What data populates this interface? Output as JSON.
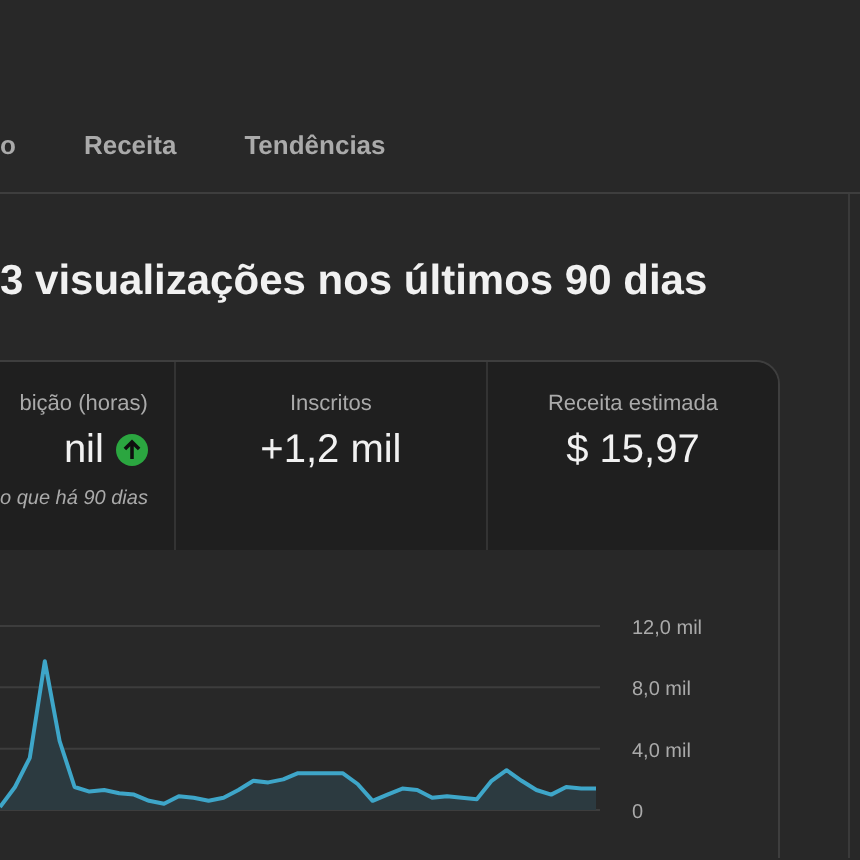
{
  "tabs": [
    {
      "label": "o",
      "selected": false
    },
    {
      "label": "Receita",
      "selected": false
    },
    {
      "label": "Tendências",
      "selected": false
    }
  ],
  "heading": "3 visualizações nos últimos 90 dias",
  "metrics": [
    {
      "label": "bição (horas)",
      "value": "nil",
      "trend_up": true,
      "note": "o que há 90 dias"
    },
    {
      "label": "Inscritos",
      "value": "+1,2 mil"
    },
    {
      "label": "Receita estimada",
      "value": "$ 15,97"
    }
  ],
  "chart": {
    "chart_data": {
      "type": "area",
      "ylim": [
        0,
        12
      ],
      "yticks": [
        {
          "value": 0,
          "label": "0"
        },
        {
          "value": 4,
          "label": "4,0 mil"
        },
        {
          "value": 8,
          "label": "8,0 mil"
        },
        {
          "value": 12,
          "label": "12,0 mil"
        }
      ],
      "series": [
        {
          "color": "#3ea6c9",
          "values": [
            0.2,
            1.5,
            3.4,
            9.7,
            4.5,
            1.5,
            1.2,
            1.3,
            1.1,
            1.0,
            0.6,
            0.4,
            0.9,
            0.8,
            0.6,
            0.8,
            1.3,
            1.9,
            1.8,
            2.0,
            2.4,
            2.4,
            2.4,
            2.4,
            1.7,
            0.6,
            1.0,
            1.4,
            1.3,
            0.8,
            0.9,
            0.8,
            0.7,
            1.9,
            2.6,
            1.9,
            1.3,
            1.0,
            1.5,
            1.4,
            1.4
          ]
        }
      ]
    }
  }
}
